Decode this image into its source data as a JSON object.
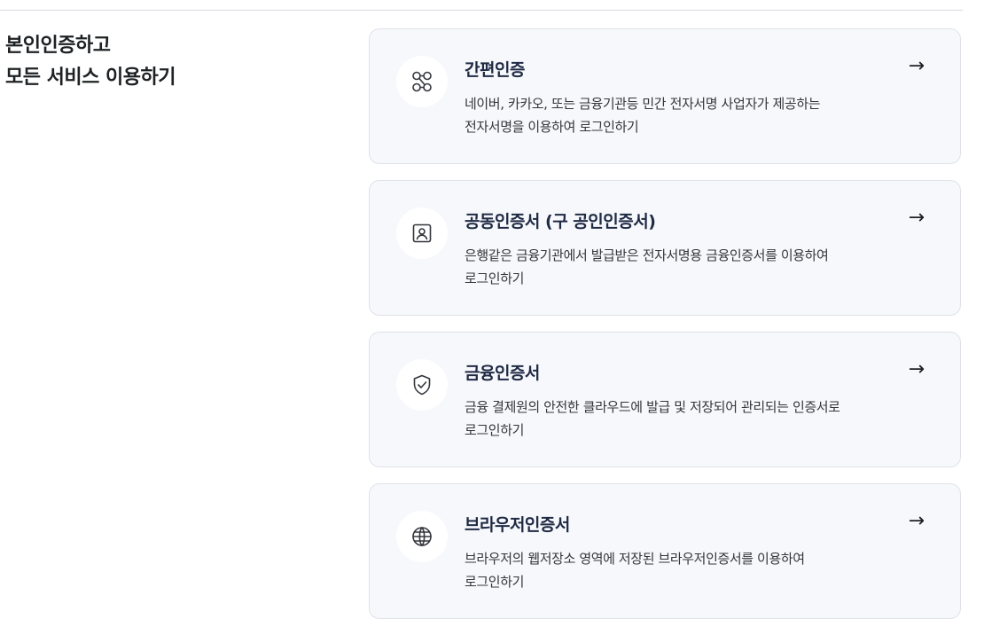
{
  "section": {
    "title_line1": "본인인증하고",
    "title_line2": "모든 서비스 이용하기"
  },
  "cards": [
    {
      "icon": "link-nodes-icon",
      "title": "간편인증",
      "desc_line1": "네이버, 카카오, 또는 금융기관등 민간 전자서명 사업자가 제공하는",
      "desc_line2": "전자서명을 이용하여 로그인하기",
      "arrow": "→"
    },
    {
      "icon": "id-card-icon",
      "title": "공동인증서 (구 공인인증서)",
      "desc_line1": "은행같은 금융기관에서 발급받은 전자서명용 금융인증서를 이용하여",
      "desc_line2": "로그인하기",
      "arrow": "→"
    },
    {
      "icon": "shield-check-icon",
      "title": "금융인증서",
      "desc_line1": "금융 결제원의 안전한 클라우드에 발급 및 저장되어 관리되는 인증서로",
      "desc_line2": "로그인하기",
      "arrow": "→"
    },
    {
      "icon": "globe-icon",
      "title": "브라우저인증서",
      "desc_line1": "브라우저의 웹저장소 영역에 저장된 브라우저인증서를 이용하여",
      "desc_line2": "로그인하기",
      "arrow": "→"
    }
  ]
}
